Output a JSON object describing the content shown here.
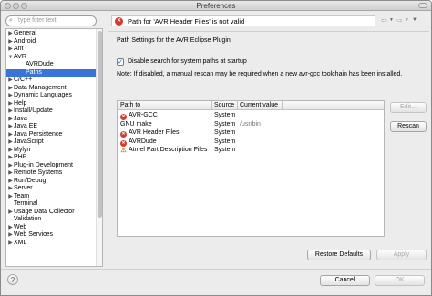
{
  "window": {
    "title": "Preferences"
  },
  "filter": {
    "placeholder": "type filter text"
  },
  "tree": [
    {
      "label": "General",
      "arrow": "▶",
      "indent": 0,
      "selected": false
    },
    {
      "label": "Android",
      "arrow": "▶",
      "indent": 0,
      "selected": false
    },
    {
      "label": "Ant",
      "arrow": "▶",
      "indent": 0,
      "selected": false
    },
    {
      "label": "AVR",
      "arrow": "▼",
      "indent": 0,
      "selected": false
    },
    {
      "label": "AVRDude",
      "arrow": "",
      "indent": 1,
      "selected": false
    },
    {
      "label": "Paths",
      "arrow": "",
      "indent": 1,
      "selected": true
    },
    {
      "label": "C/C++",
      "arrow": "▶",
      "indent": 0,
      "selected": false
    },
    {
      "label": "Data Management",
      "arrow": "▶",
      "indent": 0,
      "selected": false
    },
    {
      "label": "Dynamic Languages",
      "arrow": "▶",
      "indent": 0,
      "selected": false
    },
    {
      "label": "Help",
      "arrow": "▶",
      "indent": 0,
      "selected": false
    },
    {
      "label": "Install/Update",
      "arrow": "▶",
      "indent": 0,
      "selected": false
    },
    {
      "label": "Java",
      "arrow": "▶",
      "indent": 0,
      "selected": false
    },
    {
      "label": "Java EE",
      "arrow": "▶",
      "indent": 0,
      "selected": false
    },
    {
      "label": "Java Persistence",
      "arrow": "▶",
      "indent": 0,
      "selected": false
    },
    {
      "label": "JavaScript",
      "arrow": "▶",
      "indent": 0,
      "selected": false
    },
    {
      "label": "Mylyn",
      "arrow": "▶",
      "indent": 0,
      "selected": false
    },
    {
      "label": "PHP",
      "arrow": "▶",
      "indent": 0,
      "selected": false
    },
    {
      "label": "Plug-in Development",
      "arrow": "▶",
      "indent": 0,
      "selected": false
    },
    {
      "label": "Remote Systems",
      "arrow": "▶",
      "indent": 0,
      "selected": false
    },
    {
      "label": "Run/Debug",
      "arrow": "▶",
      "indent": 0,
      "selected": false
    },
    {
      "label": "Server",
      "arrow": "▶",
      "indent": 0,
      "selected": false
    },
    {
      "label": "Team",
      "arrow": "▶",
      "indent": 0,
      "selected": false
    },
    {
      "label": "Terminal",
      "arrow": "",
      "indent": 0,
      "selected": false
    },
    {
      "label": "Usage Data Collector",
      "arrow": "▶",
      "indent": 0,
      "selected": false
    },
    {
      "label": "Validation",
      "arrow": "",
      "indent": 0,
      "selected": false
    },
    {
      "label": "Web",
      "arrow": "▶",
      "indent": 0,
      "selected": false
    },
    {
      "label": "Web Services",
      "arrow": "▶",
      "indent": 0,
      "selected": false
    },
    {
      "label": "XML",
      "arrow": "▶",
      "indent": 0,
      "selected": false
    }
  ],
  "page": {
    "error_message": "Path for 'AVR Header Files' is not valid",
    "description": "Path Settings for the AVR Eclipse Plugin",
    "checkbox_label": "Disable search for system paths at startup",
    "checkbox_checked": true,
    "note": "Note:  If disabled, a manual rescan may be required when a new avr-gcc toolchain has been installed."
  },
  "table": {
    "headers": [
      "Path to",
      "Source",
      "Current value"
    ],
    "rows": [
      {
        "icon": "error",
        "path": "AVR-GCC",
        "source": "System",
        "value": ""
      },
      {
        "icon": "",
        "path": "GNU make",
        "source": "System",
        "value": "/usr/bin"
      },
      {
        "icon": "error",
        "path": "AVR Header Files",
        "source": "System",
        "value": ""
      },
      {
        "icon": "error",
        "path": "AVRDude",
        "source": "System",
        "value": ""
      },
      {
        "icon": "warning",
        "path": "Atmel Part Description Files",
        "source": "System",
        "value": ""
      }
    ]
  },
  "buttons": {
    "edit": "Edit...",
    "rescan": "Rescan",
    "restore_defaults": "Restore Defaults",
    "apply": "Apply",
    "cancel": "Cancel",
    "ok": "OK",
    "help": "?"
  },
  "icons": {
    "error": "error-icon",
    "warning": "warning-icon",
    "nav_back": "back-arrow-icon",
    "nav_forward": "forward-arrow-icon",
    "view_menu": "view-menu-icon",
    "search": "search-icon"
  },
  "colors": {
    "selection": "#3875d7",
    "error": "#d63a2f",
    "warning": "#d08c00"
  }
}
